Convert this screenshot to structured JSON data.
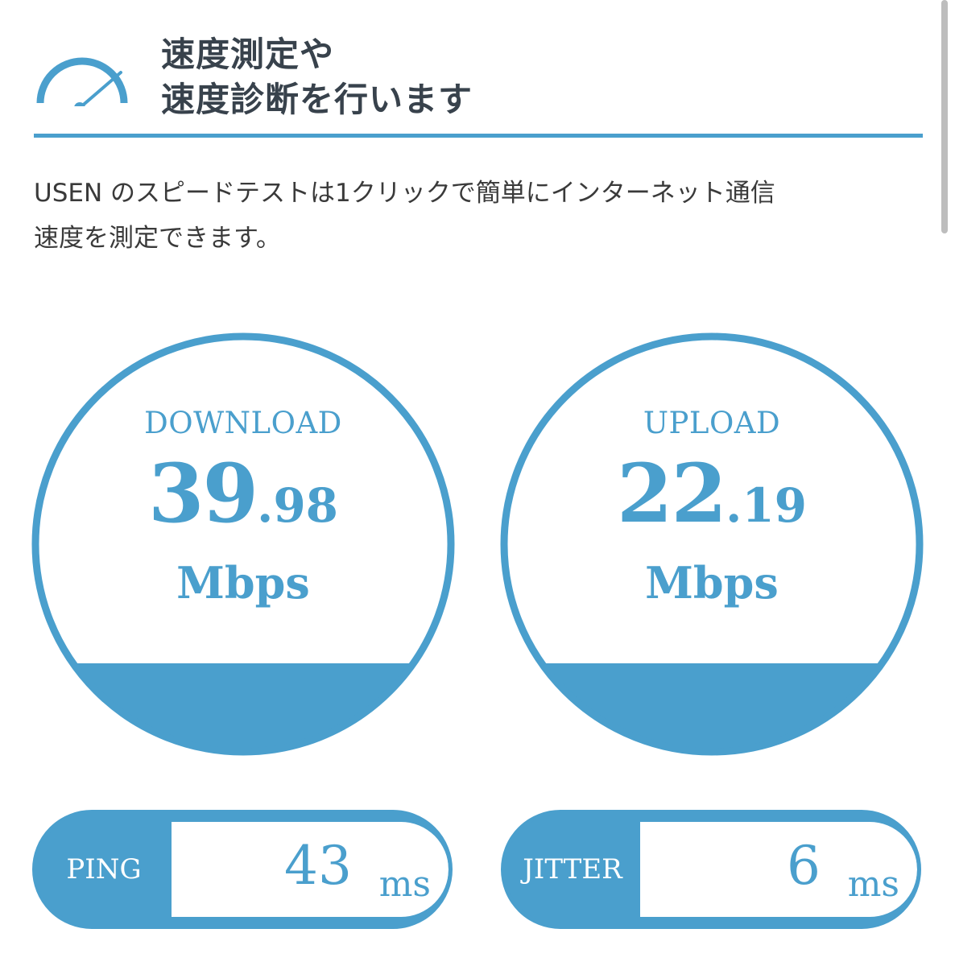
{
  "header": {
    "title_line1": "速度測定や",
    "title_line2": "速度診断を行います"
  },
  "description": {
    "line1": "USEN のスピードテストは1クリックで簡単にインターネット通信",
    "line2": "速度を測定できます。"
  },
  "download": {
    "label": "DOWNLOAD",
    "value_int": "39",
    "value_dec": ".98",
    "unit": "Mbps"
  },
  "upload": {
    "label": "UPLOAD",
    "value_int": "22",
    "value_dec": ".19",
    "unit": "Mbps"
  },
  "ping": {
    "label": "PING",
    "value": "43",
    "unit": "ms"
  },
  "jitter": {
    "label": "JITTER",
    "value": "6",
    "unit": "ms"
  },
  "colors": {
    "accent": "#4a9fcd",
    "title_text": "#38424c",
    "body_text": "#3a3a3a"
  },
  "icons": {
    "header": "speedometer-icon"
  }
}
